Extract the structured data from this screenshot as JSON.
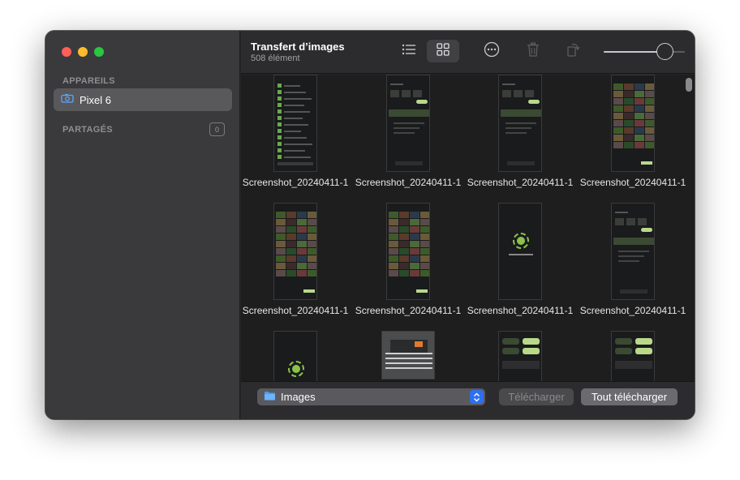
{
  "window": {
    "title": "Transfert d’images",
    "subtitle": "508 élément"
  },
  "sidebar": {
    "section_devices": "APPAREILS",
    "device": {
      "label": "Pixel 6",
      "icon": "phone-camera-icon"
    },
    "section_shared": "PARTAGÉS",
    "shared_count": "0"
  },
  "toolbar": {
    "list_view_icon": "list-icon",
    "grid_view_icon": "grid-icon",
    "more_icon": "ellipsis-circle-icon",
    "delete_icon": "trash-icon",
    "rotate_icon": "rotate-icon",
    "thumbnail_size": 0.75
  },
  "grid": {
    "items": [
      {
        "caption": "Screenshot_20240411-1",
        "kind": "list"
      },
      {
        "caption": "Screenshot_20240411-1",
        "kind": "settings"
      },
      {
        "caption": "Screenshot_20240411-1",
        "kind": "settings"
      },
      {
        "caption": "Screenshot_20240411-1",
        "kind": "gallery"
      },
      {
        "caption": "Screenshot_20240411-1",
        "kind": "gallery"
      },
      {
        "caption": "Screenshot_20240411-1",
        "kind": "gallery"
      },
      {
        "caption": "Screenshot_20240411-1",
        "kind": "loading"
      },
      {
        "caption": "Screenshot_20240411-1",
        "kind": "settings"
      },
      {
        "caption": "",
        "kind": "loading"
      },
      {
        "caption": "",
        "kind": "photo"
      },
      {
        "caption": "",
        "kind": "panel"
      },
      {
        "caption": "",
        "kind": "panel"
      }
    ]
  },
  "footer": {
    "destination": "Images",
    "download_label": "Télécharger",
    "download_all_label": "Tout télécharger"
  },
  "colors": {
    "accent": "#2f6ff0",
    "close": "#ff5f57",
    "minimize": "#febc2e",
    "zoom": "#28c840"
  }
}
